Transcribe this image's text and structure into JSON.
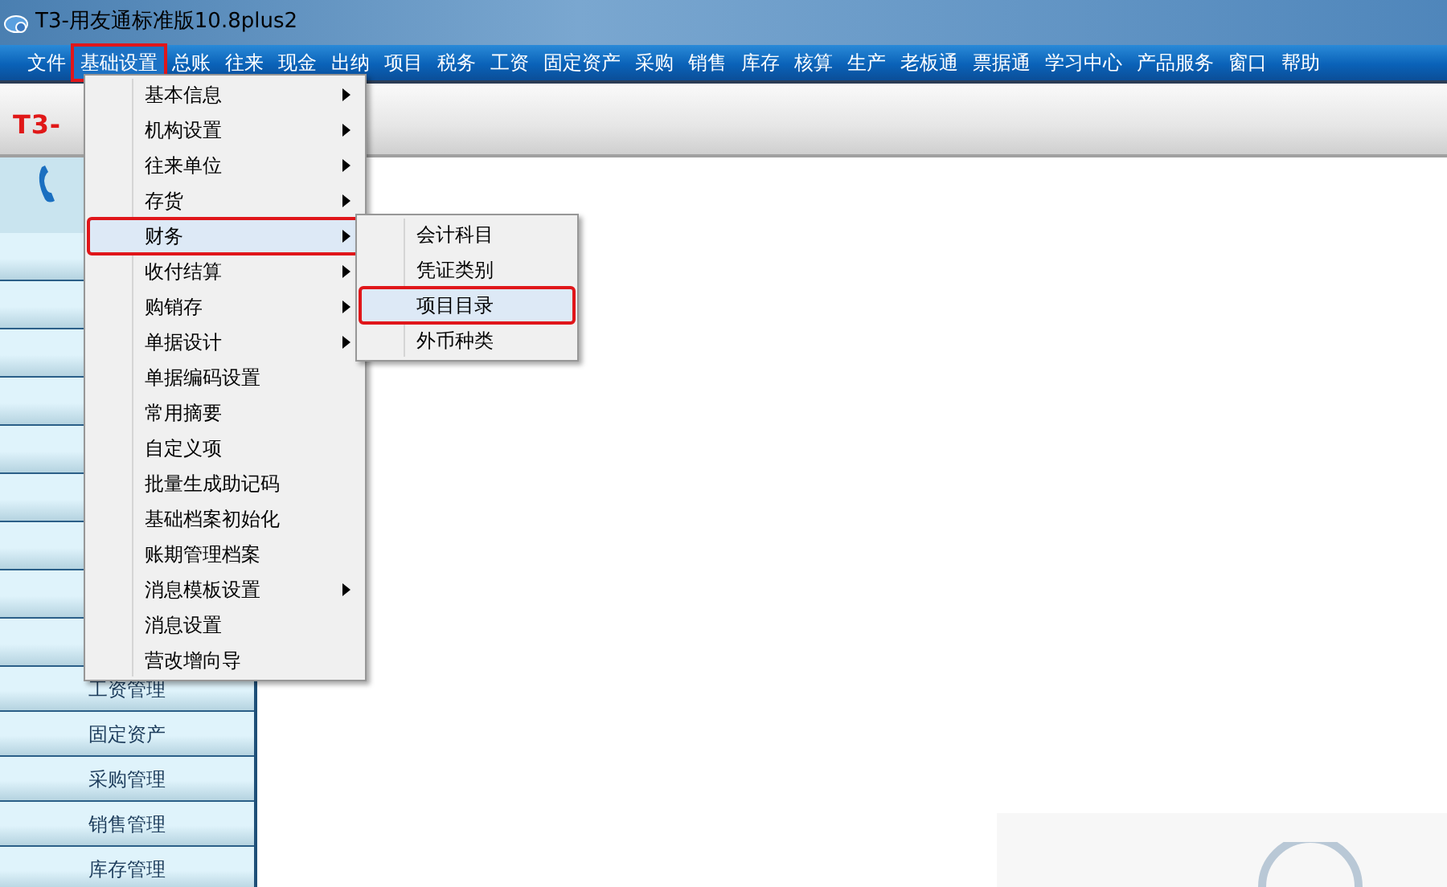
{
  "window": {
    "title": "T3-用友通标准版10.8plus2"
  },
  "menubar": [
    {
      "label": "文件",
      "open": false,
      "marked": false
    },
    {
      "label": "基础设置",
      "open": true,
      "marked": true
    },
    {
      "label": "总账",
      "open": false,
      "marked": false
    },
    {
      "label": "往来",
      "open": false,
      "marked": false
    },
    {
      "label": "现金",
      "open": false,
      "marked": false
    },
    {
      "label": "出纳",
      "open": false,
      "marked": false
    },
    {
      "label": "项目",
      "open": false,
      "marked": false
    },
    {
      "label": "税务",
      "open": false,
      "marked": false
    },
    {
      "label": "工资",
      "open": false,
      "marked": false
    },
    {
      "label": "固定资产",
      "open": false,
      "marked": false
    },
    {
      "label": "采购",
      "open": false,
      "marked": false
    },
    {
      "label": "销售",
      "open": false,
      "marked": false
    },
    {
      "label": "库存",
      "open": false,
      "marked": false
    },
    {
      "label": "核算",
      "open": false,
      "marked": false
    },
    {
      "label": "生产",
      "open": false,
      "marked": false
    },
    {
      "label": "老板通",
      "open": false,
      "marked": false
    },
    {
      "label": "票据通",
      "open": false,
      "marked": false
    },
    {
      "label": "学习中心",
      "open": false,
      "marked": false
    },
    {
      "label": "产品服务",
      "open": false,
      "marked": false
    },
    {
      "label": "窗口",
      "open": false,
      "marked": false
    },
    {
      "label": "帮助",
      "open": false,
      "marked": false
    }
  ],
  "logo": {
    "text": "T3-"
  },
  "sidebar": {
    "items": [
      {
        "label": "工资管理"
      },
      {
        "label": "固定资产"
      },
      {
        "label": "采购管理"
      },
      {
        "label": "销售管理"
      },
      {
        "label": "库存管理"
      }
    ]
  },
  "dropdown": {
    "items": [
      {
        "label": "基本信息",
        "submenu": true,
        "selected": false,
        "marked": false
      },
      {
        "label": "机构设置",
        "submenu": true,
        "selected": false,
        "marked": false
      },
      {
        "label": "往来单位",
        "submenu": true,
        "selected": false,
        "marked": false
      },
      {
        "label": "存货",
        "submenu": true,
        "selected": false,
        "marked": false
      },
      {
        "label": "财务",
        "submenu": true,
        "selected": true,
        "marked": true
      },
      {
        "label": "收付结算",
        "submenu": true,
        "selected": false,
        "marked": false
      },
      {
        "label": "购销存",
        "submenu": true,
        "selected": false,
        "marked": false
      },
      {
        "label": "单据设计",
        "submenu": true,
        "selected": false,
        "marked": false
      },
      {
        "label": "单据编码设置",
        "submenu": false,
        "selected": false,
        "marked": false
      },
      {
        "label": "常用摘要",
        "submenu": false,
        "selected": false,
        "marked": false
      },
      {
        "label": "自定义项",
        "submenu": false,
        "selected": false,
        "marked": false
      },
      {
        "label": "批量生成助记码",
        "submenu": false,
        "selected": false,
        "marked": false
      },
      {
        "label": "基础档案初始化",
        "submenu": false,
        "selected": false,
        "marked": false
      },
      {
        "label": "账期管理档案",
        "submenu": false,
        "selected": false,
        "marked": false
      },
      {
        "label": "消息模板设置",
        "submenu": true,
        "selected": false,
        "marked": false
      },
      {
        "label": "消息设置",
        "submenu": false,
        "selected": false,
        "marked": false
      },
      {
        "label": "营改增向导",
        "submenu": false,
        "selected": false,
        "marked": false
      }
    ]
  },
  "submenu": {
    "items": [
      {
        "label": "会计科目",
        "selected": false,
        "marked": false
      },
      {
        "label": "凭证类别",
        "selected": false,
        "marked": false
      },
      {
        "label": "项目目录",
        "selected": true,
        "marked": true
      },
      {
        "label": "外币种类",
        "selected": false,
        "marked": false
      }
    ]
  }
}
